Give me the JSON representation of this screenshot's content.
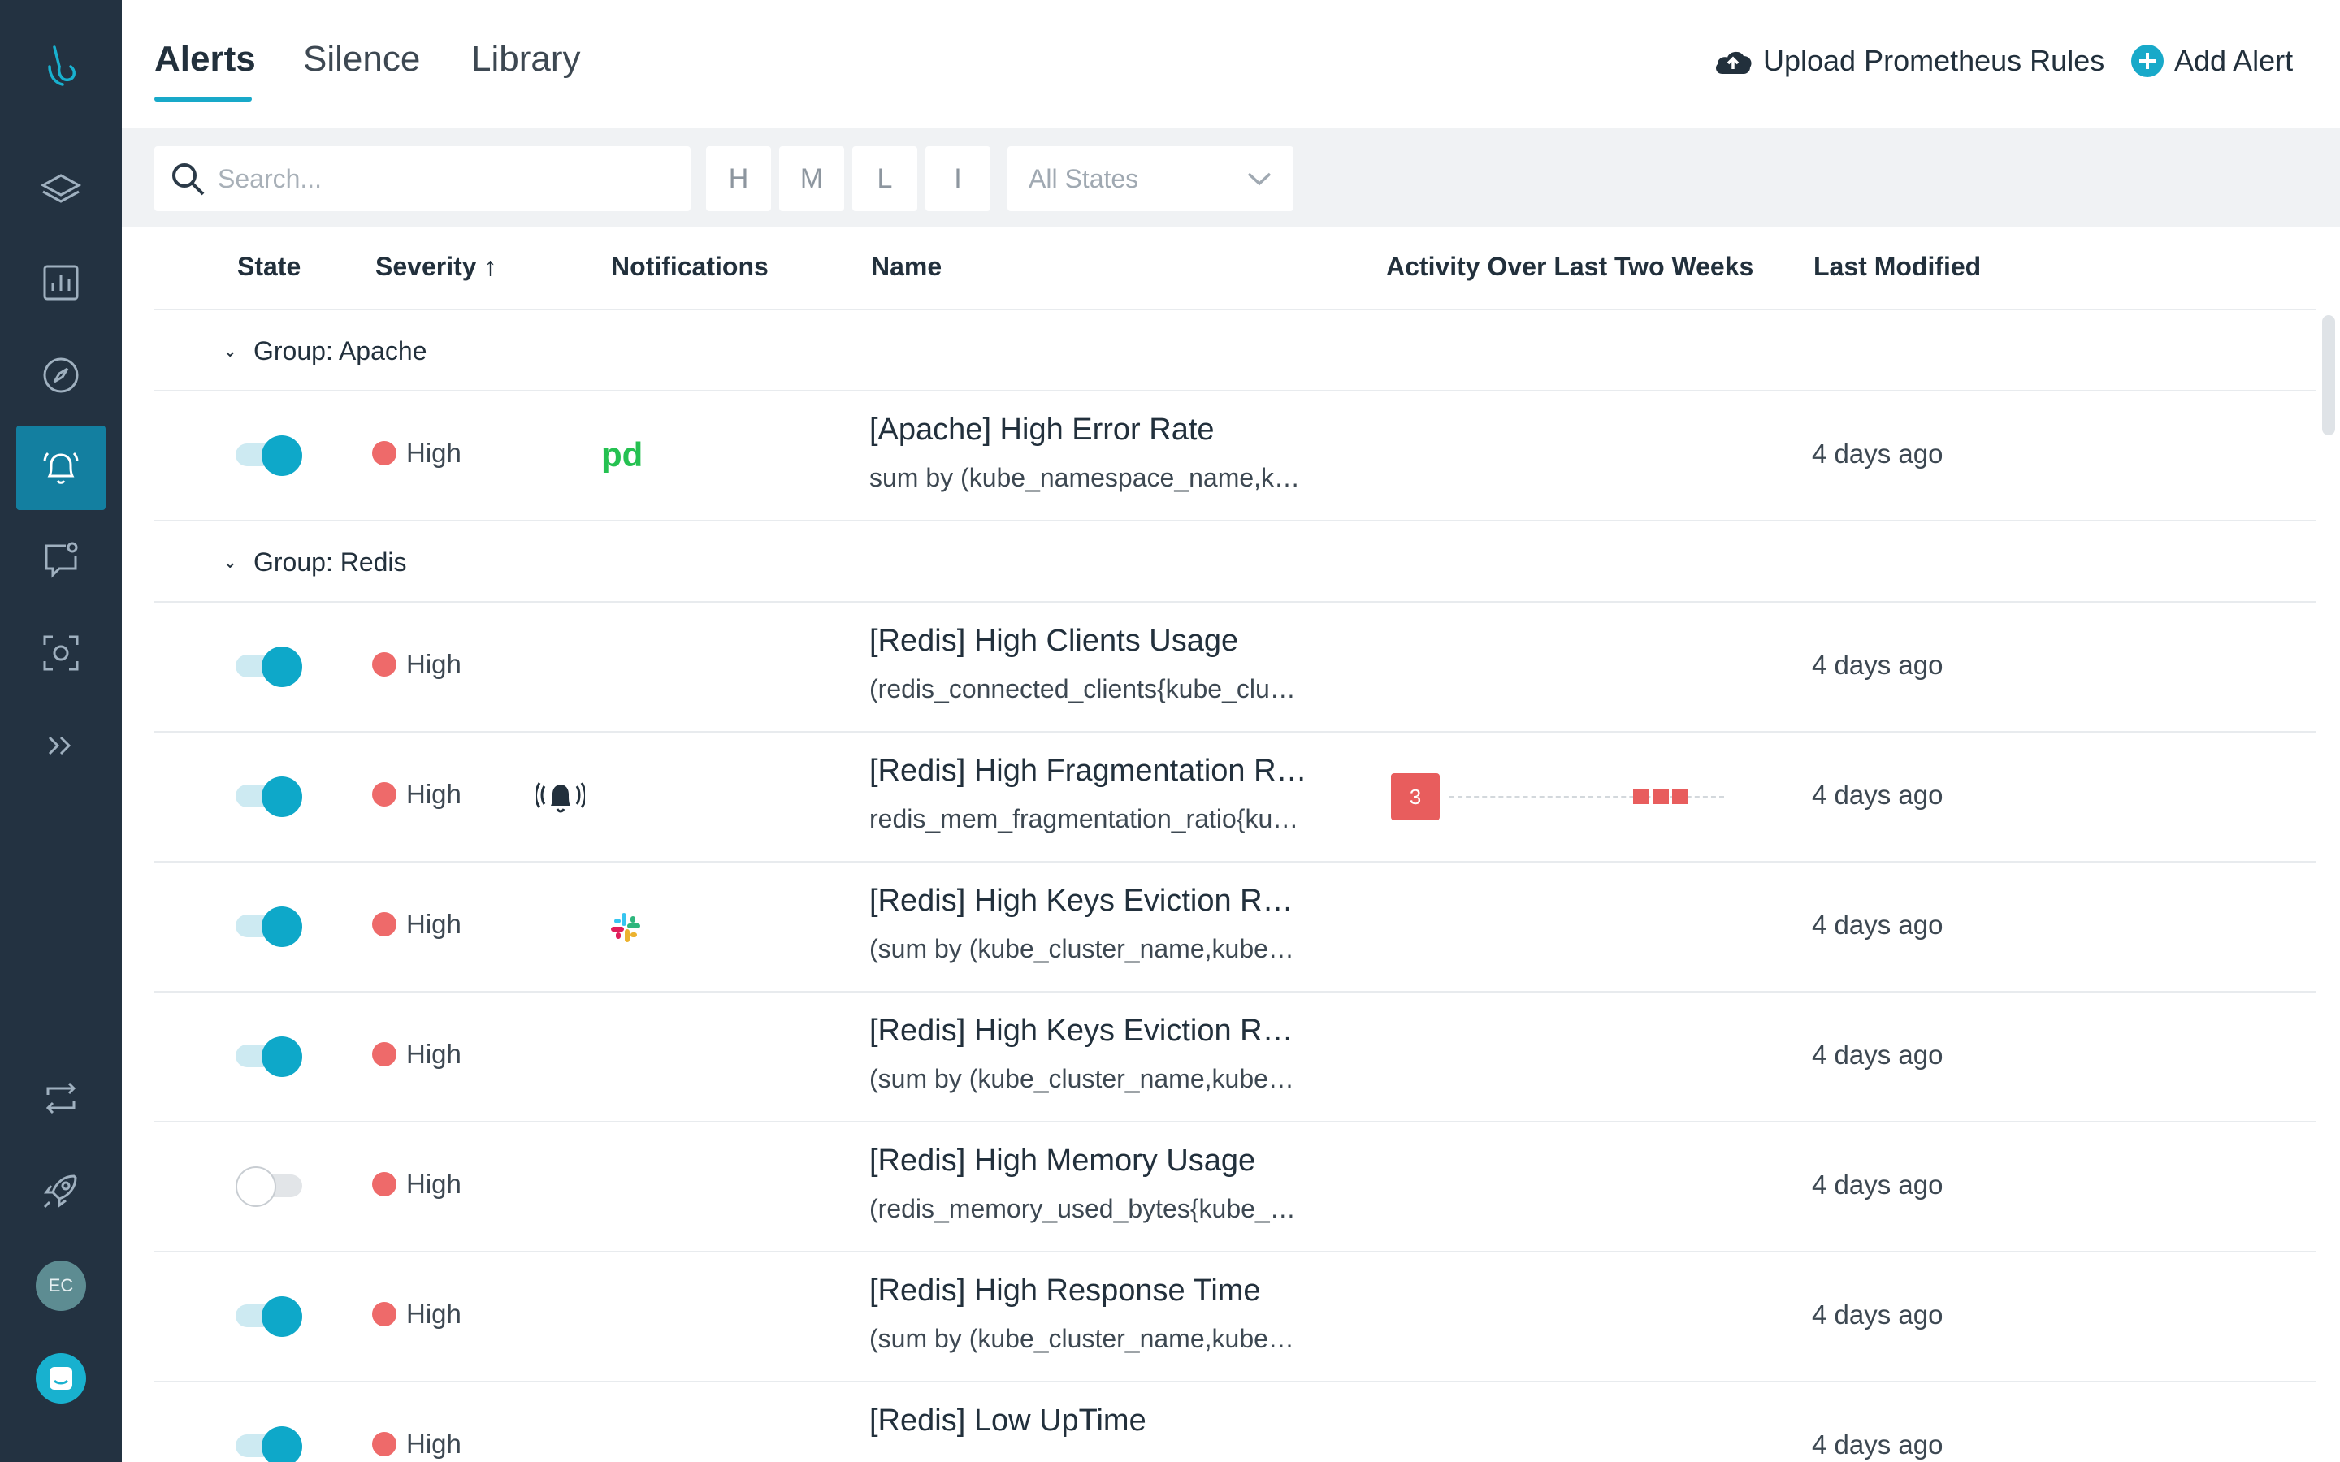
{
  "tabs": [
    {
      "label": "Alerts",
      "active": true
    },
    {
      "label": "Silence",
      "active": false
    },
    {
      "label": "Library",
      "active": false
    }
  ],
  "actions": {
    "upload_label": "Upload Prometheus Rules",
    "add_label": "Add Alert"
  },
  "filters": {
    "search_placeholder": "Search...",
    "severity_buttons": [
      "H",
      "M",
      "L",
      "I"
    ],
    "state_select": "All States"
  },
  "columns": {
    "state": "State",
    "severity": "Severity",
    "severity_sort": "↑",
    "notifications": "Notifications",
    "name": "Name",
    "activity": "Activity Over Last Two Weeks",
    "modified": "Last Modified"
  },
  "groups": [
    {
      "label": "Group: Apache"
    },
    {
      "label": "Group: Redis"
    }
  ],
  "alerts": [
    {
      "enabled": true,
      "severity": "High",
      "notification": "pagerduty-icon",
      "name": "[Apache] High Error Rate",
      "query": "sum by (kube_namespace_name,ku...",
      "modified": "4 days ago"
    },
    {
      "enabled": true,
      "severity": "High",
      "notification": "",
      "name": "[Redis] High Clients Usage",
      "query": "(redis_connected_clients{kube_clust...",
      "modified": "4 days ago"
    },
    {
      "enabled": true,
      "severity": "High",
      "notification": "alarm-bell-icon",
      "name": "[Redis] High Fragmentation Rat...",
      "query": "redis_mem_fragmentation_ratio{kub...",
      "modified": "4 days ago",
      "activity_count": "3"
    },
    {
      "enabled": true,
      "severity": "High",
      "notification": "slack-icon",
      "name": "[Redis] High Keys Eviction Ratio",
      "query": "(sum by (kube_cluster_name,kube_n...",
      "modified": "4 days ago"
    },
    {
      "enabled": true,
      "severity": "High",
      "notification": "",
      "name": "[Redis] High Keys Eviction Rati...",
      "query": "(sum by (kube_cluster_name,kube_n...",
      "modified": "4 days ago"
    },
    {
      "enabled": false,
      "severity": "High",
      "notification": "",
      "name": "[Redis] High Memory Usage",
      "query": "(redis_memory_used_bytes{kube_cl...",
      "modified": "4 days ago"
    },
    {
      "enabled": true,
      "severity": "High",
      "notification": "",
      "name": "[Redis] High Response Time",
      "query": "(sum by (kube_cluster_name,kube_n...",
      "modified": "4 days ago"
    },
    {
      "enabled": true,
      "severity": "High",
      "notification": "",
      "name": "[Redis] Low UpTime",
      "query": "",
      "modified": "4 days ago"
    }
  ],
  "user": {
    "initials": "EC"
  },
  "colors": {
    "sidebar": "#233241",
    "accent": "#18a9c9",
    "high_severity": "#ee6a6a",
    "pagerduty": "#25c151"
  }
}
